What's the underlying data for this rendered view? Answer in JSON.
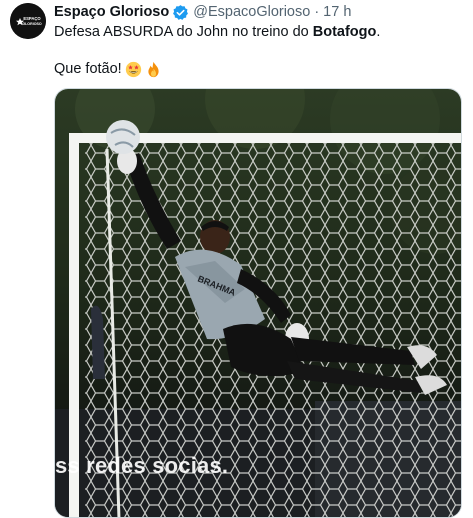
{
  "tweet": {
    "display_name": "Espaço Glorioso",
    "handle": "@EspacoGlorioso",
    "separator": "·",
    "time": "17 h",
    "text_part1": "Defesa ABSURDA do John no treino do ",
    "text_bold": "Botafogo",
    "text_part2": ".",
    "text_line2": "Que fotão!",
    "emojis": [
      "star-struck-emoji",
      "fire-emoji"
    ],
    "verified": true
  },
  "avatar": {
    "logo_text_top": "ESPAÇO",
    "logo_text_bottom": "GLORIOSO"
  },
  "media": {
    "overlay_caption": "ss redes socias.",
    "shirt_text": "BRAHMA"
  },
  "colors": {
    "text": "#0f1419",
    "secondary": "#536471",
    "verified": "#1d9bf0",
    "border": "#cfd9de"
  }
}
